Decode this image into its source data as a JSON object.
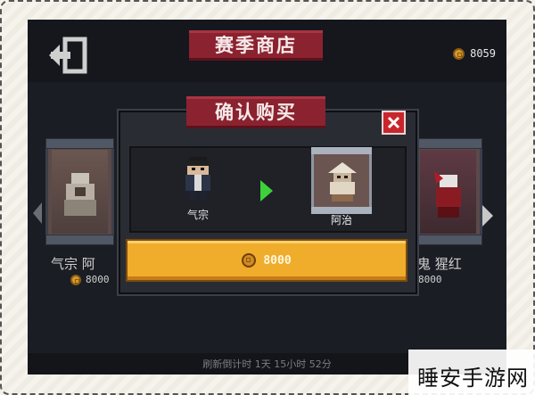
{
  "header": {
    "title": "赛季商店",
    "currency_amount": "8059"
  },
  "shop": {
    "left_card_name": "气宗 阿",
    "left_card_price": "8000",
    "right_card_name": "鬼 猩红",
    "right_card_price": "8000",
    "refresh_text": "刷新倒计时 1天 15小时 52分"
  },
  "dialog": {
    "title": "确认购买",
    "from_name": "气宗",
    "to_name": "阿治",
    "price": "8000"
  },
  "watermark": {
    "text": "睡安手游网"
  },
  "colors": {
    "ribbon": "#8b2230",
    "buy_button": "#f0ad2c",
    "close_button": "#c8262c",
    "arrow": "#3ed13a"
  }
}
